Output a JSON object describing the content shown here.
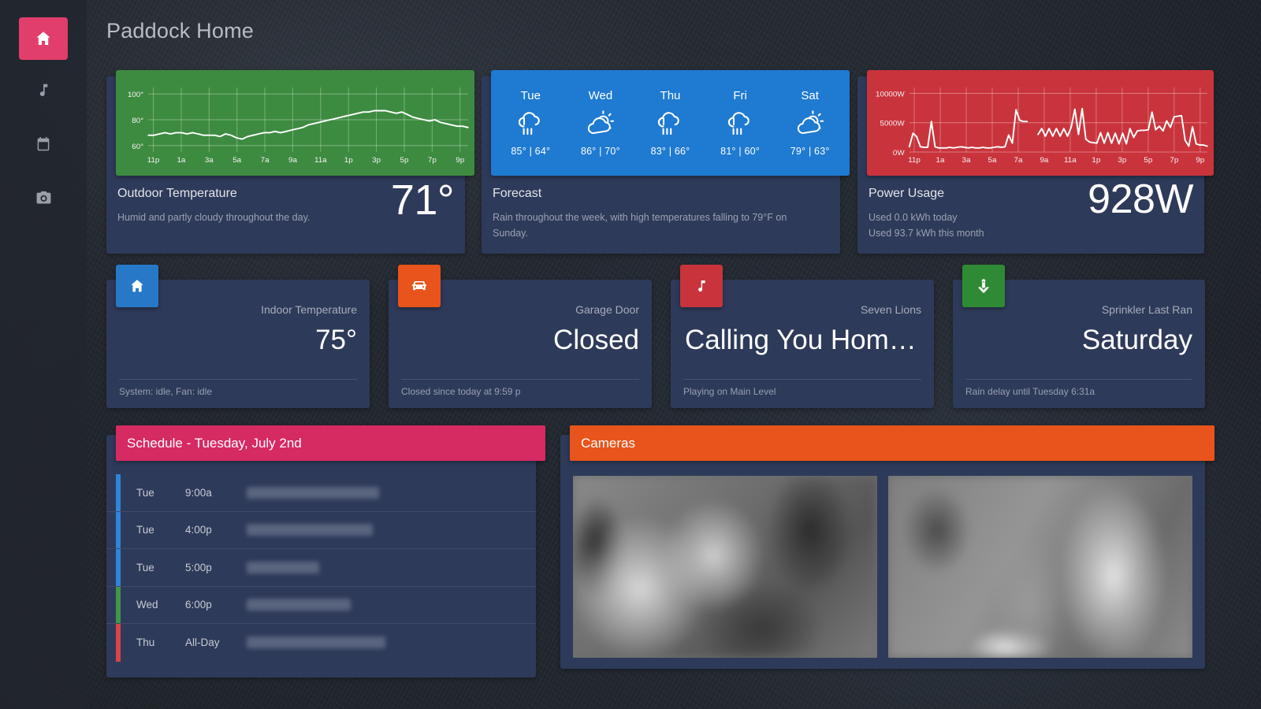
{
  "header": {
    "title": "Paddock Home"
  },
  "sidebar": {
    "items": [
      {
        "icon": "home-icon",
        "active": true
      },
      {
        "icon": "music-icon",
        "active": false
      },
      {
        "icon": "calendar-icon",
        "active": false
      },
      {
        "icon": "camera-icon",
        "active": false
      }
    ]
  },
  "colors": {
    "accent_pink": "#e23e6b",
    "card_bg": "#2e3a59",
    "green": "#3d8b40",
    "blue": "#1f7ad1",
    "red": "#c9343c",
    "orange": "#e8541b",
    "schedule_pink": "#d62a63",
    "badge_blue": "#2779c7",
    "badge_orange": "#e8541b",
    "badge_red": "#c9343c",
    "badge_green": "#2f8a35"
  },
  "outdoor": {
    "title": "Outdoor Temperature",
    "subtitle": "Humid and partly cloudy throughout the day.",
    "value": "71°"
  },
  "forecast": {
    "title": "Forecast",
    "subtitle": "Rain throughout the week, with high temperatures falling to 79°F on Sunday.",
    "days": [
      {
        "name": "Tue",
        "icon": "rain-icon",
        "temps": "85° | 64°"
      },
      {
        "name": "Wed",
        "icon": "partly-cloudy-icon",
        "temps": "86° | 70°"
      },
      {
        "name": "Thu",
        "icon": "rain-icon",
        "temps": "83° | 66°"
      },
      {
        "name": "Fri",
        "icon": "rain-icon",
        "temps": "81° | 60°"
      },
      {
        "name": "Sat",
        "icon": "partly-cloudy-icon",
        "temps": "79° | 63°"
      }
    ]
  },
  "power": {
    "title": "Power Usage",
    "sub1": "Used 0.0 kWh today",
    "sub2": "Used 93.7 kWh this month",
    "value": "928W"
  },
  "status_cards": [
    {
      "icon": "home-icon",
      "label": "Indoor Temperature",
      "value": "75°",
      "footer": "System: idle, Fan: idle"
    },
    {
      "icon": "car-icon",
      "label": "Garage Door",
      "value": "Closed",
      "footer": "Closed since today at 9:59 p"
    },
    {
      "icon": "music-icon",
      "label": "Seven Lions",
      "value": "Calling You Home…",
      "footer": "Playing on Main Level"
    },
    {
      "icon": "sprinkler-icon",
      "label": "Sprinkler Last Ran",
      "value": "Saturday",
      "footer": "Rain delay until Tuesday 6:31a"
    }
  ],
  "schedule": {
    "title": "Schedule - Tuesday, July 2nd",
    "events": [
      {
        "day": "Tue",
        "time": "9:00a",
        "title_redacted": true,
        "title_width": 168,
        "bar_color": "#2f85d8"
      },
      {
        "day": "Tue",
        "time": "4:00p",
        "title_redacted": true,
        "title_width": 160,
        "bar_color": "#2f85d8"
      },
      {
        "day": "Tue",
        "time": "5:00p",
        "title_redacted": true,
        "title_width": 92,
        "bar_color": "#2f85d8"
      },
      {
        "day": "Wed",
        "time": "6:00p",
        "title_redacted": true,
        "title_width": 132,
        "bar_color": "#3f9748"
      },
      {
        "day": "Thu",
        "time": "All-Day",
        "title_redacted": true,
        "title_width": 176,
        "bar_color": "#d9434a"
      }
    ]
  },
  "cameras": {
    "title": "Cameras",
    "feeds": [
      {
        "caption": "",
        "name": "camera-feed-left"
      },
      {
        "caption": "",
        "name": "camera-feed-right"
      }
    ]
  },
  "chart_data": [
    {
      "type": "line",
      "name": "outdoor-temperature-chart",
      "title": "Outdoor Temperature",
      "ylabel": "",
      "xlabel": "",
      "ylim": [
        55,
        105
      ],
      "yticks": [
        "60°",
        "80°",
        "100°"
      ],
      "ytick_values": [
        60,
        80,
        100
      ],
      "xticks": [
        "11p",
        "1a",
        "3a",
        "5a",
        "7a",
        "9a",
        "11a",
        "1p",
        "3p",
        "5p",
        "7p",
        "9p"
      ],
      "grid": true,
      "line_color": "#ffffff",
      "bg_color": "#3d8b40",
      "values": [
        68,
        68,
        69,
        70,
        69,
        70,
        70,
        69,
        70,
        69,
        68,
        68,
        68,
        67,
        69,
        68,
        66,
        65,
        67,
        68,
        69,
        70,
        70,
        71,
        70,
        71,
        72,
        73,
        74,
        76,
        77,
        78,
        79,
        80,
        81,
        82,
        83,
        84,
        85,
        86,
        86,
        87,
        87,
        87,
        86,
        85,
        86,
        84,
        82,
        81,
        80,
        79,
        80,
        78,
        77,
        76,
        75,
        75,
        74
      ]
    },
    {
      "type": "line",
      "name": "power-usage-chart",
      "title": "Power Usage",
      "ylabel": "",
      "xlabel": "",
      "ylim": [
        0,
        11000
      ],
      "yticks": [
        "0W",
        "5000W",
        "10000W"
      ],
      "ytick_values": [
        0,
        5000,
        10000
      ],
      "xticks": [
        "11p",
        "1a",
        "3a",
        "5a",
        "7a",
        "9a",
        "11a",
        "1p",
        "3p",
        "5p",
        "7p",
        "9p"
      ],
      "grid": true,
      "line_color": "#ffffff",
      "bg_color": "#c9343c",
      "values": [
        900,
        3200,
        2600,
        900,
        800,
        800,
        5200,
        900,
        700,
        700,
        700,
        800,
        700,
        800,
        900,
        800,
        700,
        800,
        700,
        700,
        800,
        700,
        700,
        800,
        900,
        800,
        900,
        2900,
        1500,
        7200,
        5400,
        5200,
        5200,
        null,
        null,
        3000,
        4000,
        2700,
        4000,
        2700,
        4000,
        2700,
        4000,
        2700,
        4200,
        7300,
        3000,
        7400,
        2200,
        1700,
        1600,
        1500,
        3300,
        1500,
        3300,
        1500,
        3200,
        1400,
        3200,
        1400,
        4000,
        2500,
        3600,
        3700,
        3700,
        3800,
        6800,
        3800,
        4400,
        3600,
        5300,
        4200,
        6000,
        6100,
        6200,
        2000,
        1000,
        4300,
        1400,
        1200,
        1200,
        1000
      ]
    }
  ]
}
